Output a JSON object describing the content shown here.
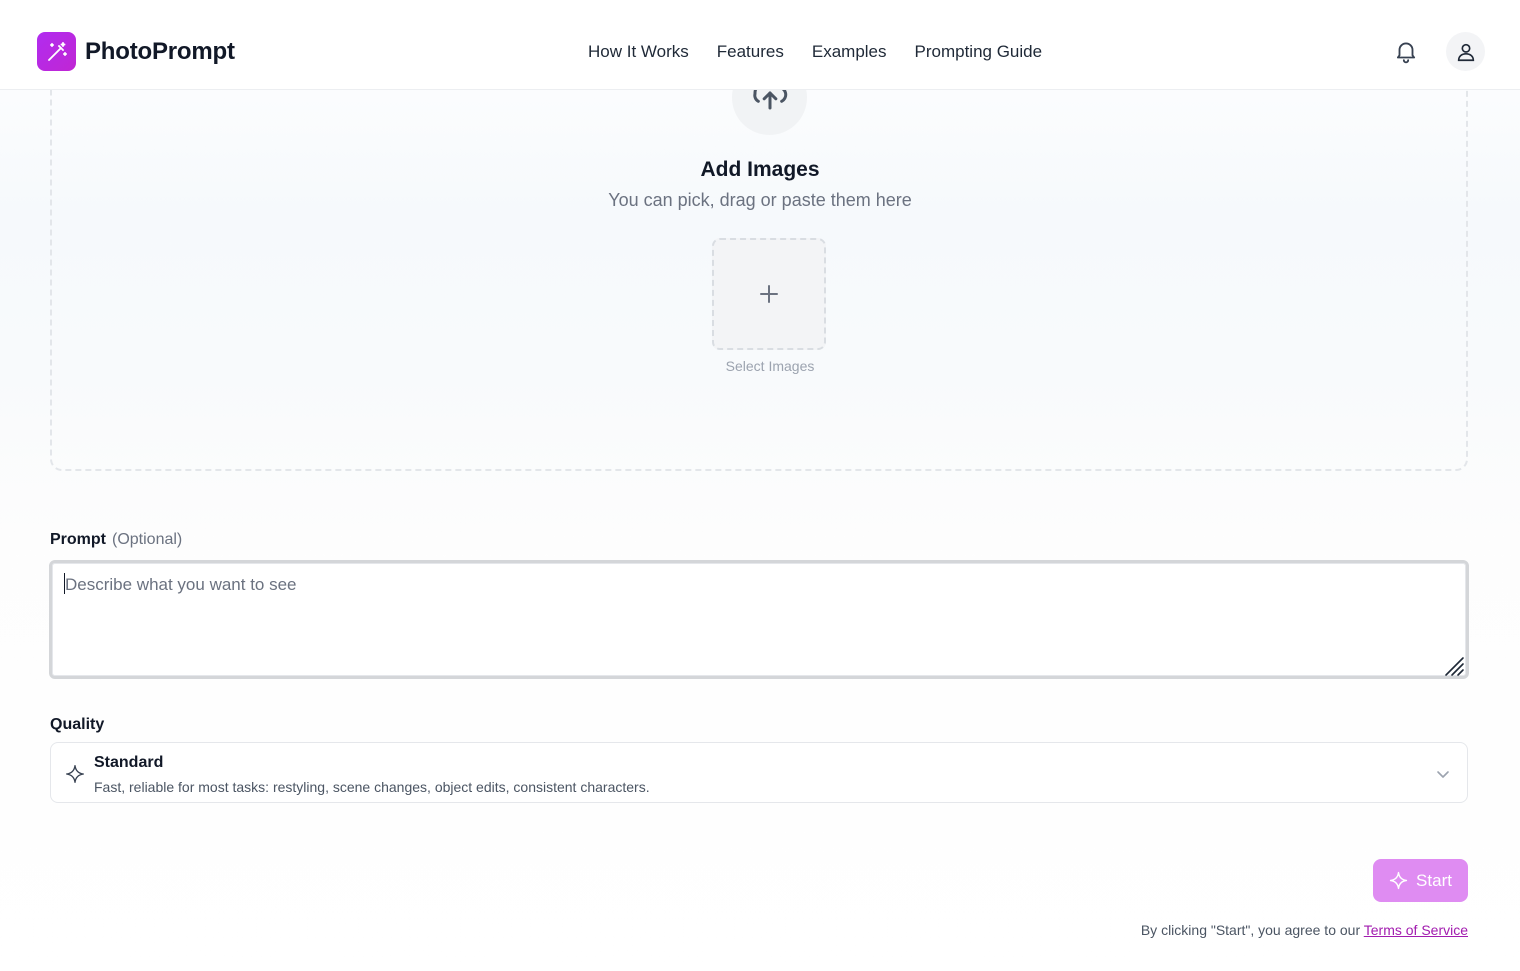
{
  "header": {
    "brand": "PhotoPrompt",
    "nav": [
      "How It Works",
      "Features",
      "Examples",
      "Prompting Guide"
    ],
    "icons": {
      "logo": "magic-wand-icon",
      "notifications": "bell-icon",
      "account": "user-icon"
    },
    "brand_color": "#c026d3"
  },
  "upload": {
    "title": "Add Images",
    "subtitle": "You can pick, drag or paste them here",
    "select_label": "Select Images",
    "icons": {
      "upload": "cloud-upload-icon",
      "add": "plus-icon"
    }
  },
  "prompt": {
    "label": "Prompt",
    "optional": "(Optional)",
    "placeholder": "Describe what you want to see",
    "value": ""
  },
  "quality": {
    "label": "Quality",
    "selected_name": "Standard",
    "selected_desc": "Fast, reliable for most tasks: restyling, scene changes, object edits, consistent characters.",
    "icons": {
      "option": "sparkle-icon",
      "expand": "chevron-down-icon"
    }
  },
  "start": {
    "label": "Start",
    "color": "#df8cf2",
    "terms_prefix": "By clicking \"Start\", you agree to our ",
    "terms_link": "Terms of Service"
  }
}
